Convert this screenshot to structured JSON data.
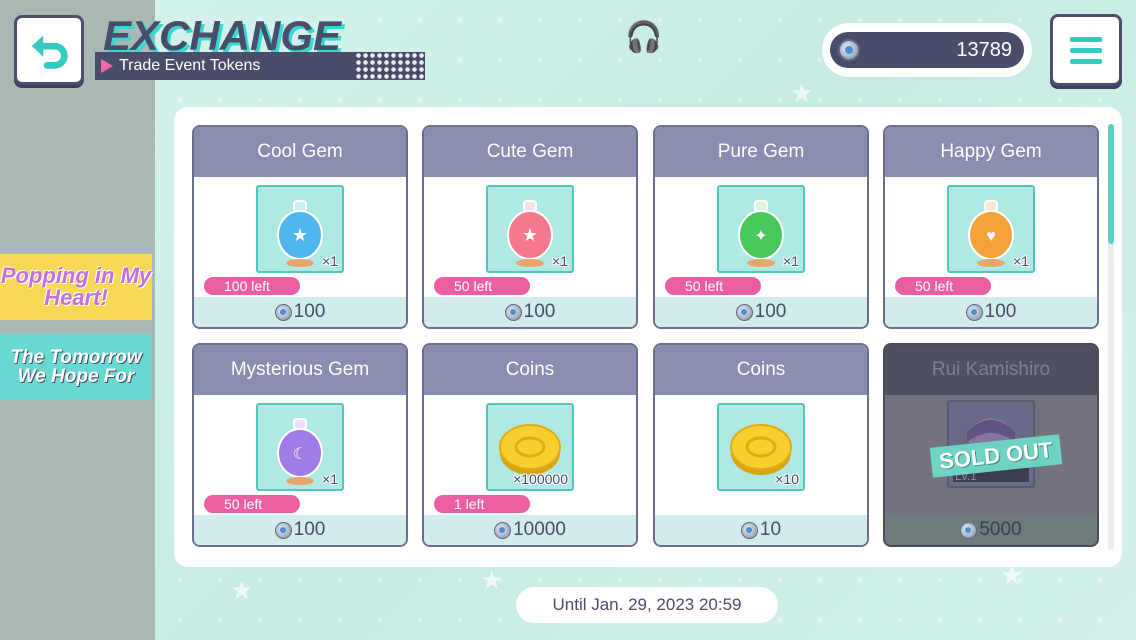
{
  "header": {
    "title": "EXCHANGE",
    "subtitle": "Trade Event Tokens",
    "back_icon": "back-arrow-icon",
    "menu_icon": "hamburger-menu-icon"
  },
  "currency": {
    "icon": "event-token-icon",
    "amount": "13789"
  },
  "events": [
    {
      "label": "Popping in My Heart!"
    },
    {
      "label": "The Tomorrow We Hope For"
    }
  ],
  "items": [
    {
      "name": "Cool Gem",
      "qty": "×1",
      "left": "100 left",
      "price": "100",
      "gem_color": "#4fb6ef"
    },
    {
      "name": "Cute Gem",
      "qty": "×1",
      "left": "50 left",
      "price": "100",
      "gem_color": "#f5788c"
    },
    {
      "name": "Pure Gem",
      "qty": "×1",
      "left": "50 left",
      "price": "100",
      "gem_color": "#46c85a"
    },
    {
      "name": "Happy Gem",
      "qty": "×1",
      "left": "50 left",
      "price": "100",
      "gem_color": "#f4a23a"
    },
    {
      "name": "Mysterious Gem",
      "qty": "×1",
      "left": "50 left",
      "price": "100",
      "gem_color": "#a07be6"
    },
    {
      "name": "Coins",
      "qty": "×100000",
      "left": "1 left",
      "price": "10000"
    },
    {
      "name": "Coins",
      "qty": "×10",
      "left": "",
      "price": "10"
    },
    {
      "name": "Rui Kamishiro",
      "level": "Lv.1",
      "sold_out_label": "SOLD OUT",
      "price": "5000"
    }
  ],
  "deadline": "Until Jan. 29, 2023 20:59",
  "colors": {
    "accent": "#34c9c1",
    "dark": "#4a4d69",
    "badge": "#ec5ea2",
    "card_header": "#8a8cb0"
  }
}
